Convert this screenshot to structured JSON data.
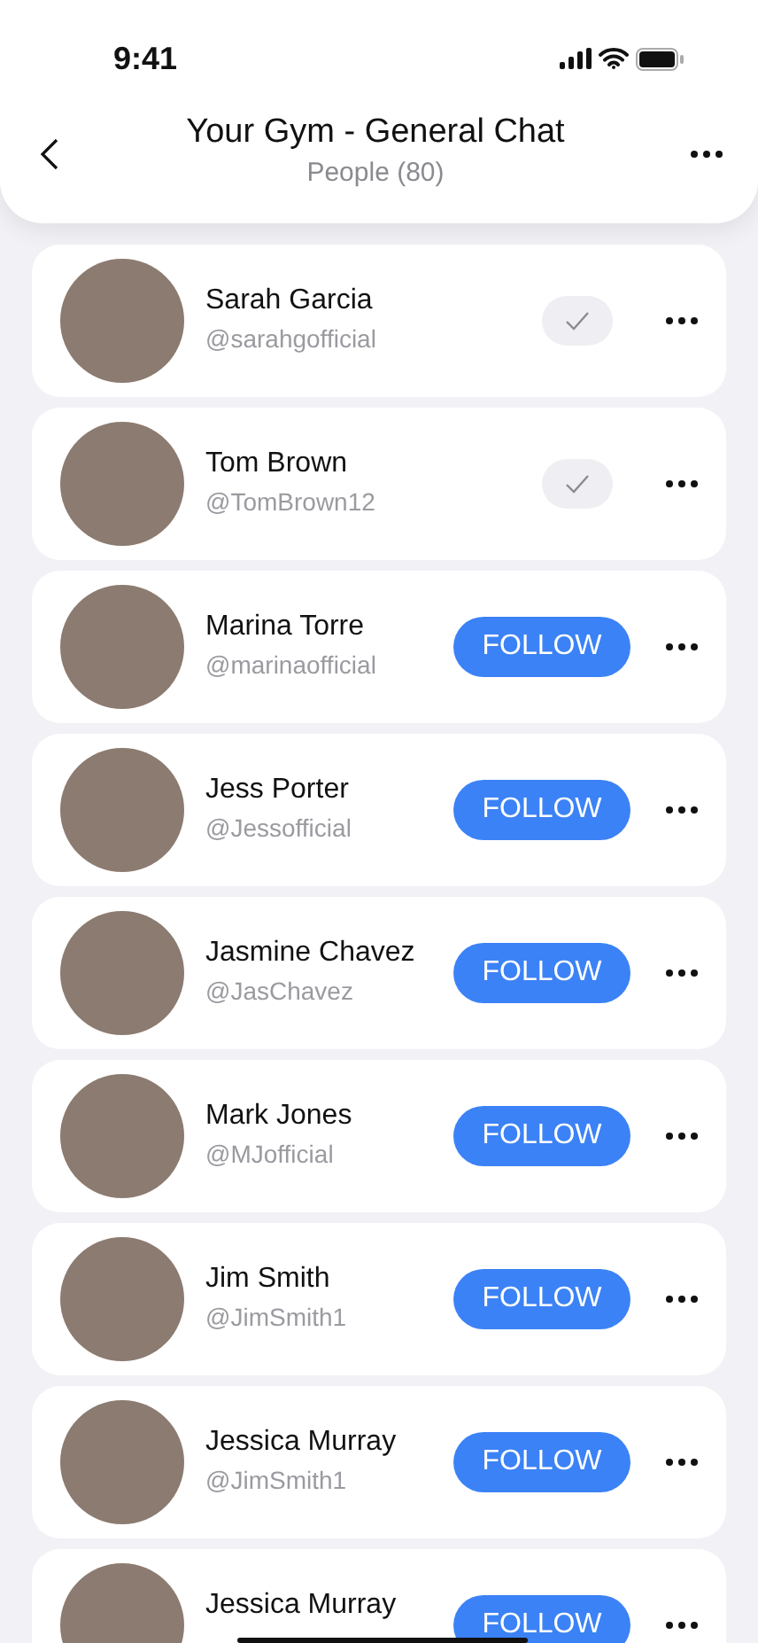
{
  "status_bar": {
    "time": "9:41"
  },
  "header": {
    "title": "Your Gym - General Chat",
    "subtitle": "People (80)"
  },
  "people": [
    {
      "name": "Sarah Garcia",
      "handle": "@sarahgofficial",
      "following": true
    },
    {
      "name": "Tom Brown",
      "handle": "@TomBrown12",
      "following": true
    },
    {
      "name": "Marina Torre",
      "handle": "@marinaofficial",
      "following": false,
      "button_label": "FOLLOW"
    },
    {
      "name": "Jess Porter",
      "handle": "@Jessofficial",
      "following": false,
      "button_label": "FOLLOW"
    },
    {
      "name": "Jasmine Chavez",
      "handle": "@JasChavez",
      "following": false,
      "button_label": "FOLLOW"
    },
    {
      "name": "Mark Jones",
      "handle": "@MJofficial",
      "following": false,
      "button_label": "FOLLOW"
    },
    {
      "name": "Jim Smith",
      "handle": "@JimSmith1",
      "following": false,
      "button_label": "FOLLOW"
    },
    {
      "name": "Jessica Murray",
      "handle": "@JimSmith1",
      "following": false,
      "button_label": "FOLLOW"
    },
    {
      "name": "Jessica Murray",
      "following": false,
      "button_label": "FOLLOW"
    }
  ]
}
